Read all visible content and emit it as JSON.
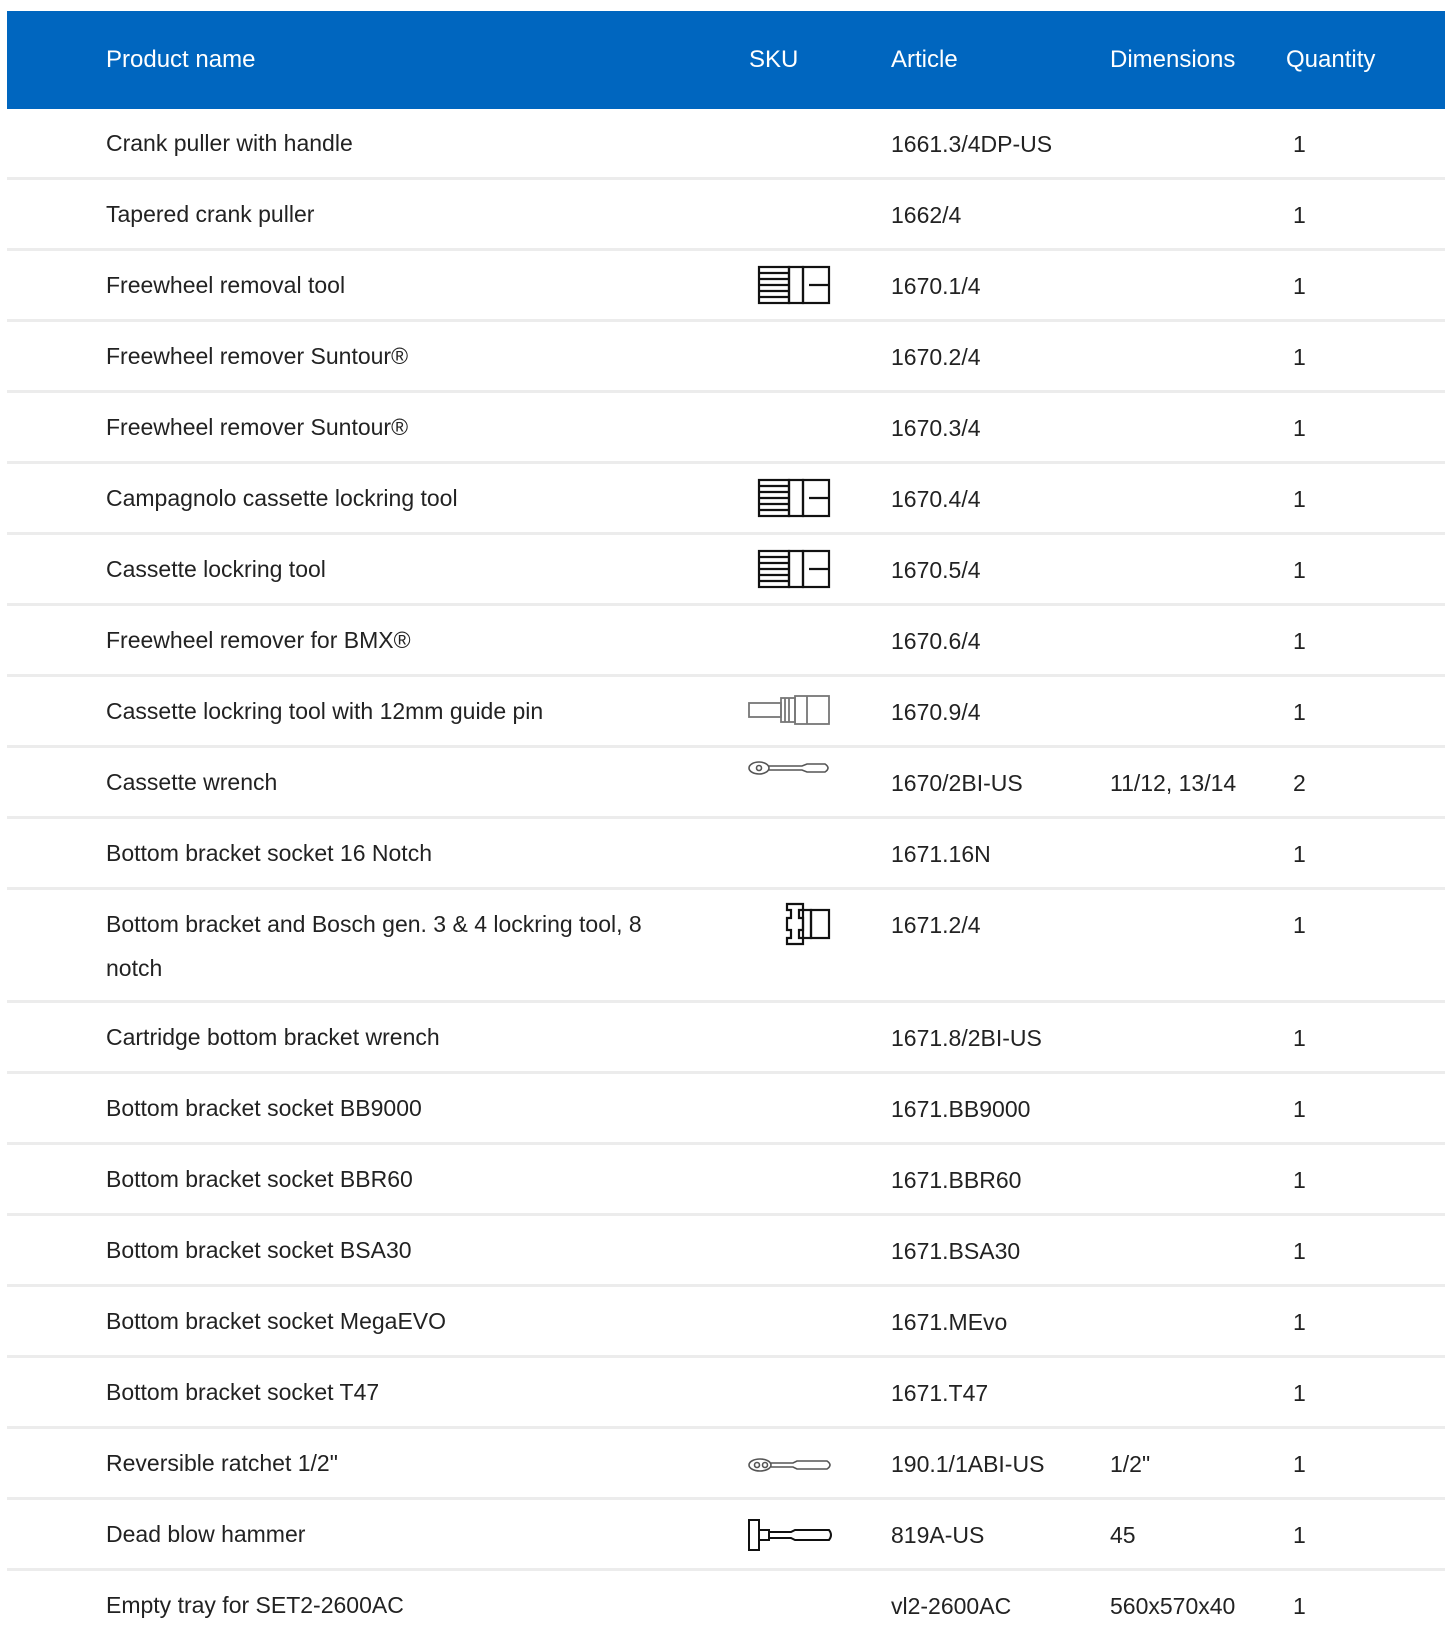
{
  "header": {
    "product_name": "Product name",
    "sku": "SKU",
    "article": "Article",
    "dimensions": "Dimensions",
    "quantity": "Quantity"
  },
  "colors": {
    "header_bg": "#0066bf",
    "header_text": "#ffffff",
    "divider": "#ececec"
  },
  "rows": [
    {
      "name": "Crank puller with handle",
      "icon": "",
      "article": "1661.3/4DP-US",
      "dimensions": "",
      "quantity": "1"
    },
    {
      "name": "Tapered crank puller",
      "icon": "",
      "article": "1662/4",
      "dimensions": "",
      "quantity": "1"
    },
    {
      "name": "Freewheel removal tool",
      "icon": "socket-icon",
      "article": "1670.1/4",
      "dimensions": "",
      "quantity": "1"
    },
    {
      "name": "Freewheel remover Suntour®",
      "icon": "",
      "article": "1670.2/4",
      "dimensions": "",
      "quantity": "1"
    },
    {
      "name": "Freewheel remover Suntour®",
      "icon": "",
      "article": "1670.3/4",
      "dimensions": "",
      "quantity": "1"
    },
    {
      "name": "Campagnolo cassette lockring tool",
      "icon": "socket-icon",
      "article": "1670.4/4",
      "dimensions": "",
      "quantity": "1"
    },
    {
      "name": "Cassette lockring tool",
      "icon": "socket-icon",
      "article": "1670.5/4",
      "dimensions": "",
      "quantity": "1"
    },
    {
      "name": "Freewheel remover for BMX®",
      "icon": "",
      "article": "1670.6/4",
      "dimensions": "",
      "quantity": "1"
    },
    {
      "name": "Cassette lockring tool with 12mm guide pin",
      "icon": "pin-socket-icon",
      "article": "1670.9/4",
      "dimensions": "",
      "quantity": "1"
    },
    {
      "name": "Cassette wrench",
      "icon": "wrench-icon",
      "article": "1670/2BI-US",
      "dimensions": "11/12, 13/14",
      "quantity": "2"
    },
    {
      "name": "Bottom bracket socket 16 Notch",
      "icon": "",
      "article": "1671.16N",
      "dimensions": "",
      "quantity": "1"
    },
    {
      "name": "Bottom bracket and Bosch gen. 3 & 4 lockring tool, 8 notch",
      "icon": "notch-socket-icon",
      "article": "1671.2/4",
      "dimensions": "",
      "quantity": "1"
    },
    {
      "name": "Cartridge bottom bracket wrench",
      "icon": "",
      "article": "1671.8/2BI-US",
      "dimensions": "",
      "quantity": "1"
    },
    {
      "name": "Bottom bracket socket BB9000",
      "icon": "",
      "article": "1671.BB9000",
      "dimensions": "",
      "quantity": "1"
    },
    {
      "name": "Bottom bracket socket BBR60",
      "icon": "",
      "article": "1671.BBR60",
      "dimensions": "",
      "quantity": "1"
    },
    {
      "name": "Bottom bracket socket BSA30",
      "icon": "",
      "article": "1671.BSA30",
      "dimensions": "",
      "quantity": "1"
    },
    {
      "name": "Bottom bracket socket MegaEVO",
      "icon": "",
      "article": "1671.MEvo",
      "dimensions": "",
      "quantity": "1"
    },
    {
      "name": "Bottom bracket socket T47",
      "icon": "",
      "article": "1671.T47",
      "dimensions": "",
      "quantity": "1"
    },
    {
      "name": "Reversible ratchet 1/2\"",
      "icon": "ratchet-icon",
      "article": "190.1/1ABI-US",
      "dimensions": "1/2\"",
      "quantity": "1"
    },
    {
      "name": "Dead blow hammer",
      "icon": "hammer-icon",
      "article": "819A-US",
      "dimensions": "45",
      "quantity": "1"
    },
    {
      "name": "Empty tray for SET2-2600AC",
      "icon": "",
      "article": "vl2-2600AC",
      "dimensions": "560x570x40",
      "quantity": "1"
    }
  ]
}
